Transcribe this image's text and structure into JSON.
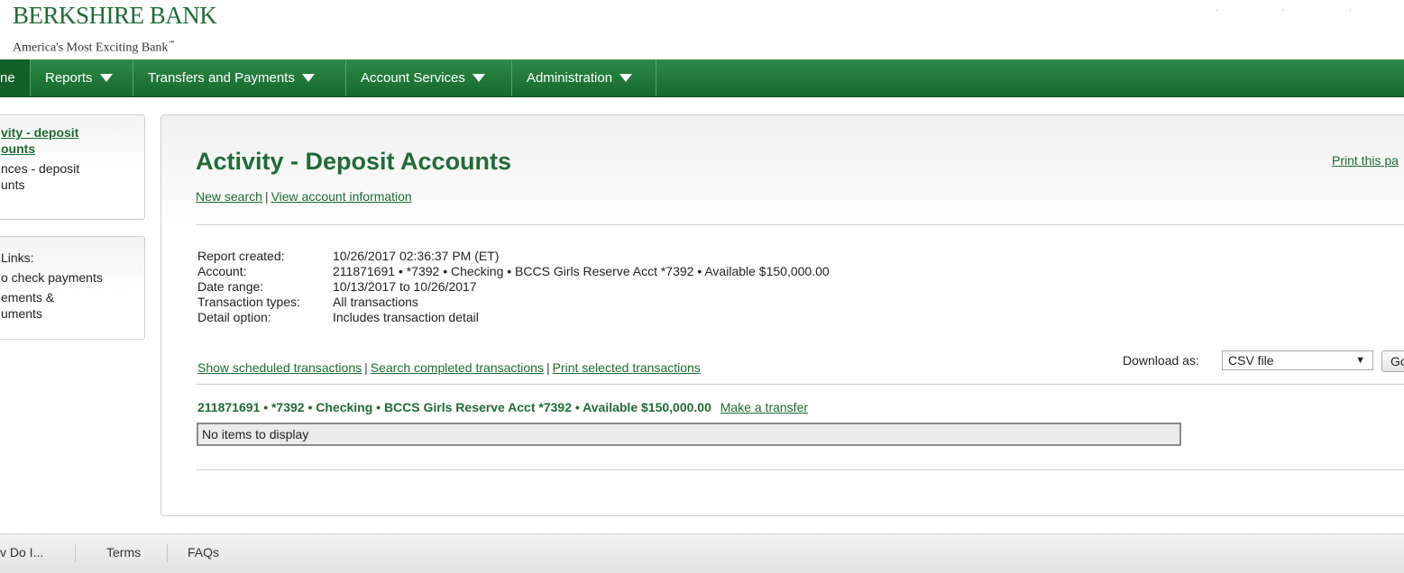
{
  "header": {
    "logo_text": "BERKSHIRE BANK",
    "tagline": "America's Most Exciting Bank",
    "tagline_mark": "℠",
    "top_dots": "· · ·"
  },
  "nav": {
    "home": "ne",
    "reports": "Reports",
    "transfers": "Transfers and Payments",
    "account_services": "Account Services",
    "administration": "Administration"
  },
  "sidebar": {
    "activity_line1": "vity - deposit",
    "activity_line2": "ounts",
    "balances_line1": "nces - deposit",
    "balances_line2": "unts",
    "links_title": "Links:",
    "check_payments": "o check payments",
    "statements_line1": "ements &",
    "statements_line2": "uments"
  },
  "main": {
    "title": "Activity - Deposit Accounts",
    "print_link": "Print this pa",
    "new_search": "New search",
    "view_account_info": "View account information",
    "pipe": "|",
    "report": {
      "created_label": "Report created:",
      "created_value": "10/26/2017 02:36:37 PM (ET)",
      "account_label": "Account:",
      "account_value": "211871691 • *7392 • Checking • BCCS Girls Reserve Acct *7392 • Available $150,000.00",
      "date_range_label": "Date range:",
      "date_range_value": "10/13/2017 to 10/26/2017",
      "types_label": "Transaction types:",
      "types_value": "All transactions",
      "detail_label": "Detail option:",
      "detail_value": "Includes transaction detail"
    },
    "show_scheduled": "Show scheduled transactions",
    "search_completed": "Search completed transactions",
    "print_selected": "Print selected transactions",
    "download_label": "Download as:",
    "download_selected": "CSV file",
    "go_label": "Go",
    "account_heading": "211871691 • *7392 • Checking • BCCS Girls Reserve Acct *7392 • Available $150,000.00",
    "make_transfer": "Make a transfer",
    "no_items": "No items to display"
  },
  "footer": {
    "how_do_i": "v Do I...",
    "terms": "Terms",
    "faqs": "FAQs"
  }
}
